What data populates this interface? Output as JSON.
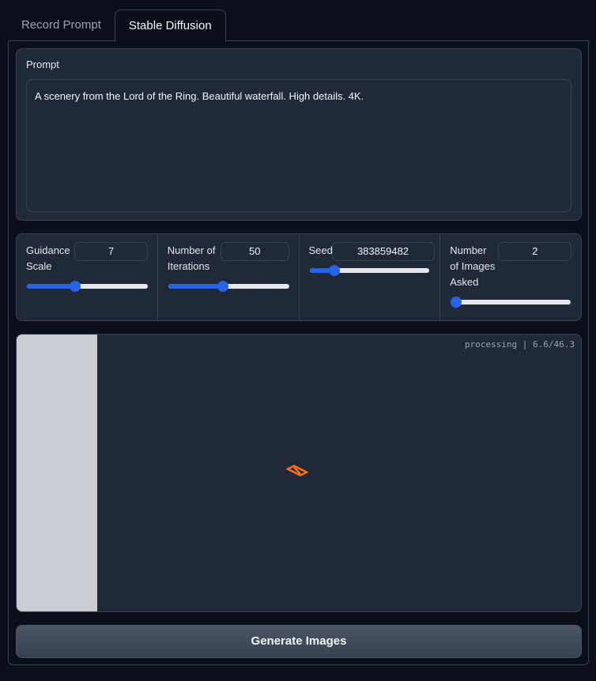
{
  "tabs": [
    {
      "label": "Record Prompt",
      "active": false
    },
    {
      "label": "Stable Diffusion",
      "active": true
    }
  ],
  "prompt": {
    "label": "Prompt",
    "value": "A scenery from the Lord of the Ring. Beautiful waterfall. High details. 4K."
  },
  "sliders": {
    "guidance": {
      "label_line1": "Guidance",
      "label_line2": "Scale",
      "value": "7",
      "level": 0.4
    },
    "iterations": {
      "label_line1": "Number of",
      "label_line2": "Iterations",
      "value": "50",
      "level": 0.45
    },
    "seed": {
      "label": "Seed",
      "value": "383859482",
      "level": 0.21
    },
    "images": {
      "label_line1": "Number",
      "label_line2": "of Images",
      "label_line3": "Asked",
      "value": "2",
      "level": 0.0
    }
  },
  "gallery": {
    "status": "processing | 6.6/46.3",
    "loader_icon": "loading-spinner-icon"
  },
  "generate_button": {
    "label": "Generate Images"
  },
  "colors": {
    "accent": "#2563eb",
    "loader": "#f97316",
    "background": "#0b0f19",
    "panel": "#1f2937"
  }
}
